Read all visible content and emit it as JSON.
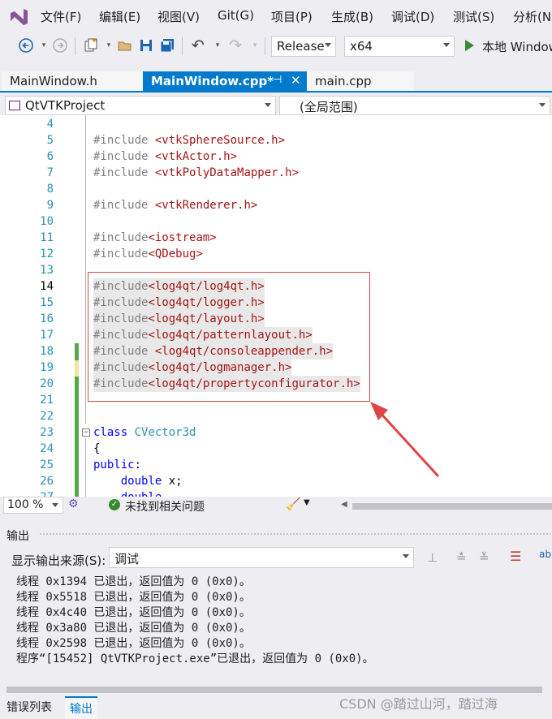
{
  "menu": {
    "items": [
      "文件(F)",
      "编辑(E)",
      "视图(V)",
      "Git(G)",
      "项目(P)",
      "生成(B)",
      "调试(D)",
      "测试(S)",
      "分析(N)"
    ]
  },
  "toolbar": {
    "config": "Release",
    "platform": "x64",
    "run_label": "本地 Windows"
  },
  "tabs": [
    {
      "label": "MainWindow.h"
    },
    {
      "label": "MainWindow.cpp*"
    },
    {
      "label": "main.cpp"
    }
  ],
  "nav": {
    "project": "QtVTKProject",
    "scope": "(全局范围)"
  },
  "editor": {
    "lines": [
      {
        "num": "4",
        "code": ""
      },
      {
        "num": "5",
        "code": "#include <vtkSphereSource.h>"
      },
      {
        "num": "6",
        "code": "#include <vtkActor.h>"
      },
      {
        "num": "7",
        "code": "#include <vtkPolyDataMapper.h>"
      },
      {
        "num": "8",
        "code": ""
      },
      {
        "num": "9",
        "code": "#include <vtkRenderer.h>"
      },
      {
        "num": "10",
        "code": ""
      },
      {
        "num": "11",
        "code": "#include<iostream>"
      },
      {
        "num": "12",
        "code": "#include<QDebug>"
      },
      {
        "num": "13",
        "code": ""
      },
      {
        "num": "14",
        "code": "#include<log4qt/log4qt.h>"
      },
      {
        "num": "15",
        "code": "#include<log4qt/logger.h>"
      },
      {
        "num": "16",
        "code": "#include<log4qt/layout.h>"
      },
      {
        "num": "17",
        "code": "#include<log4qt/patternlayout.h>"
      },
      {
        "num": "18",
        "code": "#include <log4qt/consoleappender.h>"
      },
      {
        "num": "19",
        "code": "#include<log4qt/logmanager.h>"
      },
      {
        "num": "20",
        "code": "#include<log4qt/propertyconfigurator.h>"
      },
      {
        "num": "21",
        "code": ""
      },
      {
        "num": "22",
        "code": ""
      },
      {
        "num": "23",
        "code": "class CVector3d"
      },
      {
        "num": "24",
        "code": "{"
      },
      {
        "num": "25",
        "code": "public:"
      },
      {
        "num": "26",
        "code": "    double x;"
      },
      {
        "num": "27",
        "code": "    double"
      }
    ]
  },
  "status": {
    "zoom": "100 %",
    "issues": "未找到相关问题"
  },
  "output": {
    "title": "输出",
    "source_label": "显示输出来源(S):",
    "source_value": "调试",
    "lines": [
      "线程 0x1394 已退出，返回值为 0 (0x0)。",
      "线程 0x5518 已退出，返回值为 0 (0x0)。",
      "线程 0x4c40 已退出，返回值为 0 (0x0)。",
      "线程 0x3a80 已退出，返回值为 0 (0x0)。",
      "线程 0x2598 已退出，返回值为 0 (0x0)。",
      "程序“[15452] QtVTKProject.exe”已退出，返回值为 0 (0x0)。"
    ]
  },
  "bottom_tabs": [
    "错误列表",
    "输出"
  ],
  "watermark": "CSDN @踏过山河，踏过海",
  "colors": {
    "accent": "#007acc",
    "annotation": "#e04343",
    "change_bar": "#57a64a"
  }
}
